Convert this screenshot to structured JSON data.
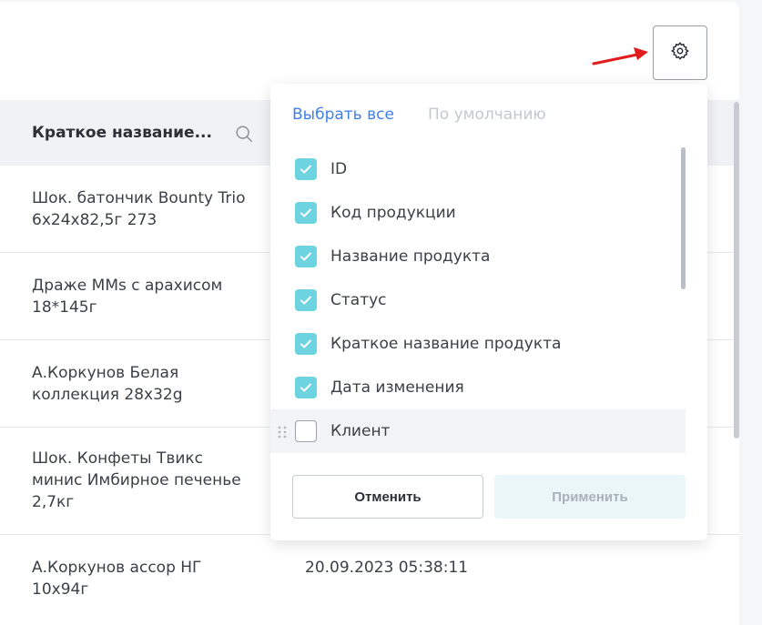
{
  "table": {
    "column_title": "Краткое название...",
    "rows": [
      {
        "name": "Шок. батончик Bounty Trio 6x24x82,5г 273",
        "date": ""
      },
      {
        "name": "Драже MMs с арахисом 18*145г",
        "date": ""
      },
      {
        "name": "А.Коркунов Белая коллекция 28x32g",
        "date": ""
      },
      {
        "name": "Шок. Конфеты Твикс минис Имбирное печенье 2,7кг",
        "date": ""
      },
      {
        "name": "А.Коркунов ассор НГ 10x94г",
        "date": "20.09.2023 05:38:11"
      }
    ]
  },
  "popup": {
    "select_all": "Выбрать все",
    "default": "По умолчанию",
    "options": [
      {
        "label": "ID",
        "checked": true
      },
      {
        "label": "Код продукции",
        "checked": true
      },
      {
        "label": "Название продукта",
        "checked": true
      },
      {
        "label": "Статус",
        "checked": true
      },
      {
        "label": "Краткое название продукта",
        "checked": true
      },
      {
        "label": "Дата изменения",
        "checked": true
      },
      {
        "label": "Клиент",
        "checked": false
      }
    ],
    "cancel": "Отменить",
    "apply": "Применить"
  },
  "icons": {
    "settings": "gear-icon",
    "search": "search-icon",
    "check": "check-icon",
    "drag": "drag-handle-icon",
    "annotation": "red-arrow"
  },
  "colors": {
    "accent_link": "#3f80e8",
    "checkbox": "#6dd3e0",
    "arrow": "#e31b1b"
  }
}
